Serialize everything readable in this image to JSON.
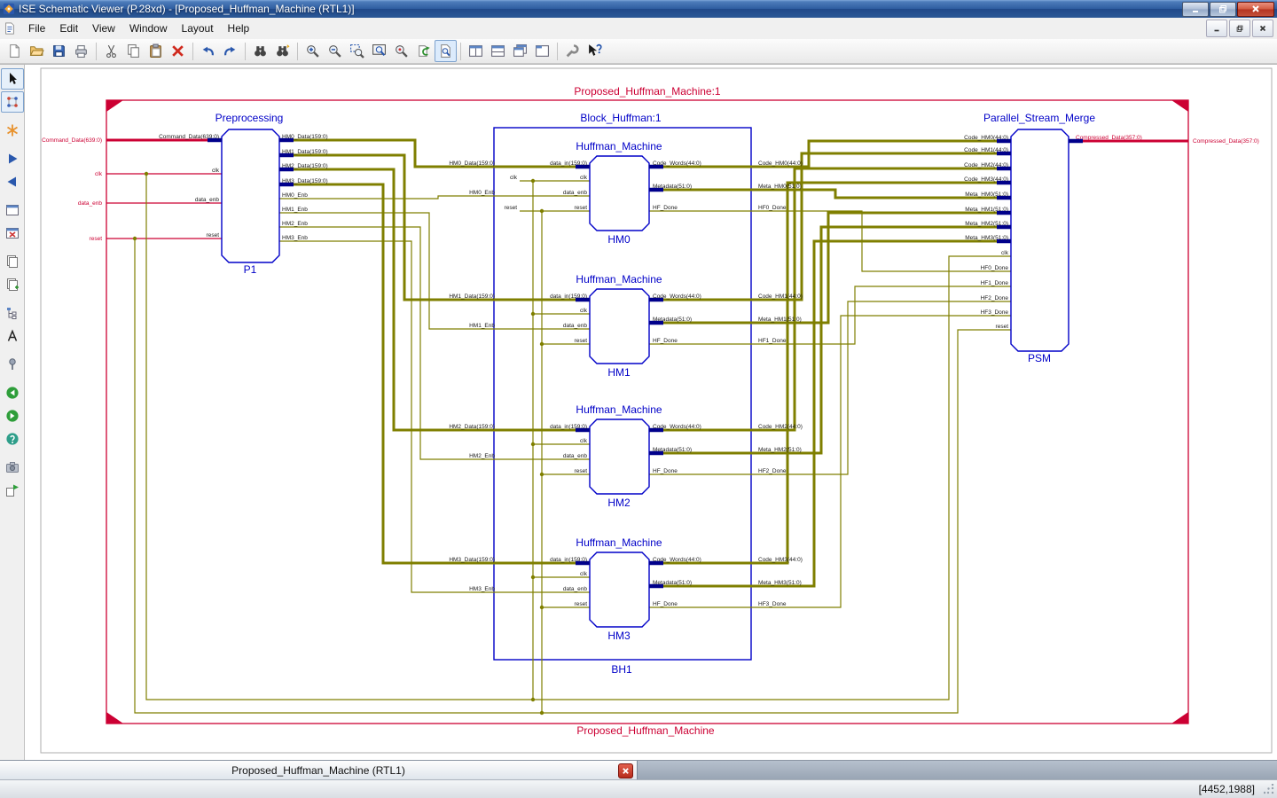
{
  "window": {
    "title": "ISE Schematic Viewer (P.28xd) - [Proposed_Huffman_Machine (RTL1)]",
    "controls": [
      "minimize",
      "restore",
      "close"
    ]
  },
  "menu": {
    "items": [
      "File",
      "Edit",
      "View",
      "Window",
      "Layout",
      "Help"
    ],
    "mdi_controls": [
      "minimize",
      "restore",
      "close"
    ]
  },
  "toolbar": {
    "buttons": [
      "new-file",
      "open",
      "save",
      "print",
      "cut",
      "copy",
      "paste",
      "delete",
      "undo",
      "redo",
      "find",
      "find-next",
      "zoom-in",
      "zoom-out",
      "zoom-area",
      "zoom-fit",
      "zoom-selection",
      "refresh-view",
      "viewer-mode",
      "tile-horizontal",
      "tile-vertical",
      "cascade-windows",
      "tab-group",
      "settings-wrench",
      "whats-this-help"
    ]
  },
  "side_toolbar": {
    "buttons": [
      "select-pointer",
      "net-select",
      "highlight",
      "run",
      "previous-view",
      "new-window",
      "close-window",
      "sheets",
      "sheet-copy",
      "hierarchy",
      "text-label",
      "pin",
      "nav-back",
      "nav-forward",
      "nav-help",
      "snapshot",
      "export"
    ]
  },
  "schematic": {
    "top_label": "Proposed_Huffman_Machine:1",
    "bottom_label": "Proposed_Huffman_Machine",
    "ports": {
      "inputs": [
        "Command_Data(639:0)",
        "clk",
        "data_enb",
        "reset"
      ],
      "output": "Compressed_Data(357:0)"
    },
    "preprocessing": {
      "title": "Preprocessing",
      "ref": "P1",
      "inputs": [
        "Command_Data(639:0)",
        "clk",
        "data_enb",
        "reset"
      ],
      "outputs": [
        "HM0_Data(159:0)",
        "HM1_Data(159:0)",
        "HM2_Data(159:0)",
        "HM3_Data(159:0)",
        "HM0_Enb",
        "HM1_Enb",
        "HM2_Enb",
        "HM3_Enb"
      ]
    },
    "block_huffman": {
      "title": "Block_Huffman:1",
      "ref": "BH1"
    },
    "hm": [
      {
        "title": "Huffman_Machine",
        "ref": "HM0",
        "inputs": [
          "data_in(159:0)",
          "clk",
          "data_enb",
          "reset"
        ],
        "outputs": [
          "Code_Words(44:0)",
          "Metadata(51:0)",
          "HF_Done"
        ],
        "in_nets": [
          "HM0_Data(159:0)",
          "clk",
          "HM0_Enb",
          "reset"
        ],
        "out_nets": [
          "Code_HM0(44:0)",
          "Meta_HM0(51:0)",
          "HF0_Done"
        ]
      },
      {
        "title": "Huffman_Machine",
        "ref": "HM1",
        "inputs": [
          "data_in(159:0)",
          "clk",
          "data_enb",
          "reset"
        ],
        "outputs": [
          "Code_Words(44:0)",
          "Metadata(51:0)",
          "HF_Done"
        ],
        "in_nets": [
          "HM1_Data(159:0)",
          "",
          "HM1_Enb",
          ""
        ],
        "out_nets": [
          "Code_HM1(44:0)",
          "Meta_HM1(51:0)",
          "HF1_Done"
        ]
      },
      {
        "title": "Huffman_Machine",
        "ref": "HM2",
        "inputs": [
          "data_in(159:0)",
          "clk",
          "data_enb",
          "reset"
        ],
        "outputs": [
          "Code_Words(44:0)",
          "Metadata(51:0)",
          "HF_Done"
        ],
        "in_nets": [
          "HM2_Data(159:0)",
          "",
          "HM2_Enb",
          ""
        ],
        "out_nets": [
          "Code_HM2(44:0)",
          "Meta_HM2(51:0)",
          "HF2_Done"
        ]
      },
      {
        "title": "Huffman_Machine",
        "ref": "HM3",
        "inputs": [
          "data_in(159:0)",
          "clk",
          "data_enb",
          "reset"
        ],
        "outputs": [
          "Code_Words(44:0)",
          "Metadata(51:0)",
          "HF_Done"
        ],
        "in_nets": [
          "HM3_Data(159:0)",
          "",
          "HM3_Enb",
          ""
        ],
        "out_nets": [
          "Code_HM3(44:0)",
          "Meta_HM3(51:0)",
          "HF3_Done"
        ]
      }
    ],
    "psm": {
      "title": "Parallel_Stream_Merge",
      "ref": "PSM",
      "inputs": [
        "Code_HM0(44:0)",
        "Code_HM1(44:0)",
        "Code_HM2(44:0)",
        "Code_HM3(44:0)",
        "Meta_HM0(51:0)",
        "Meta_HM1(51:0)",
        "Meta_HM2(51:0)",
        "Meta_HM3(51:0)",
        "clk",
        "HF0_Done",
        "HF1_Done",
        "HF2_Done",
        "HF3_Done",
        "reset"
      ],
      "output": "Compressed_Data(357:0)",
      "out_net": "Compressed_Data(357:0)"
    }
  },
  "tabbar": {
    "tab_label": "Proposed_Huffman_Machine (RTL1)"
  },
  "statusbar": {
    "coordinates": "[4452,1988]"
  },
  "colors": {
    "wire_olive": "#7f7f00",
    "component_blue": "#0000c8",
    "annotation_red": "#cc0033",
    "bus_stub_navy": "#00008b",
    "selection_blue": "#7da2ce"
  }
}
